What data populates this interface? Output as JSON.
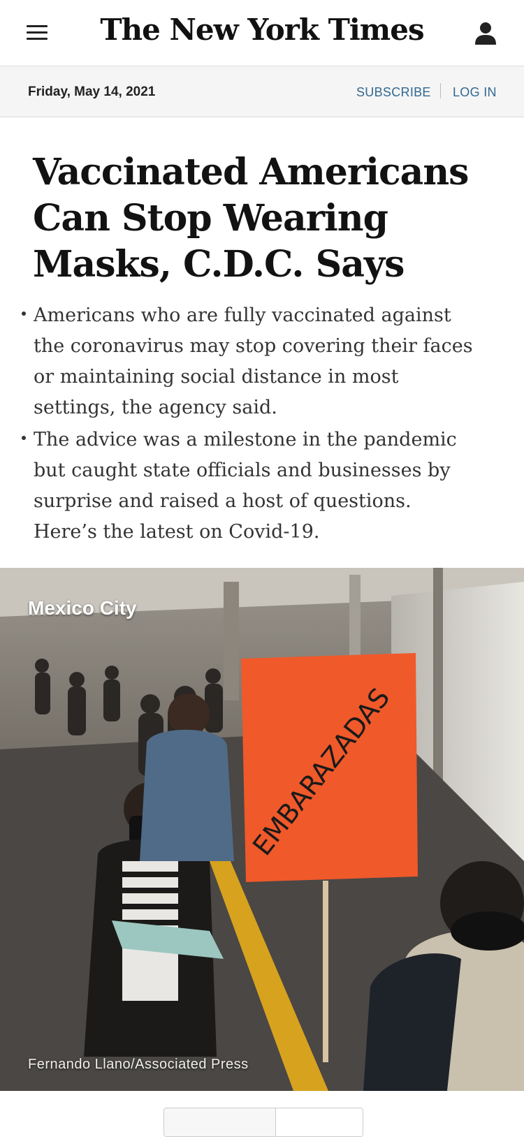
{
  "header": {
    "logo_text": "The New York Times",
    "menu_icon": "hamburger-menu-icon",
    "account_icon": "user-icon"
  },
  "datebar": {
    "date": "Friday, May 14, 2021",
    "subscribe_label": "SUBSCRIBE",
    "login_label": "LOG IN"
  },
  "article": {
    "headline": "Vaccinated Americans Can Stop Wearing Masks, C.D.C. Says",
    "bullets": [
      "Americans who are fully vaccinated against the coronavirus may stop covering their faces or maintaining social distance in most settings, the agency said.",
      "The advice was a milestone in the pandemic but caught state officials and businesses by surprise and raised a host of questions. Here’s the latest on Covid-19."
    ],
    "image": {
      "location_label": "Mexico City",
      "sign_text": "EMBARAZADAS",
      "credit": "Fernando Llano/Associated Press"
    }
  },
  "colors": {
    "link": "#326891",
    "datebar_bg": "#f5f5f5",
    "sign_orange": "#f0592a"
  }
}
